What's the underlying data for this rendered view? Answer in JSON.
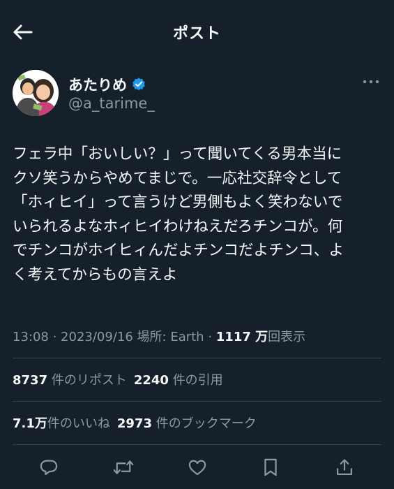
{
  "header": {
    "title": "ポスト",
    "back_icon": "arrow-left-icon"
  },
  "author": {
    "display_name": "あたりめ",
    "handle": "@a_tarime_",
    "verified": true,
    "verified_color": "#1d9bf0"
  },
  "tweet": {
    "lines": [
      "フェラ中「おいしい？」って聞いてくる男本当に",
      "クソ笑うからやめてまじで。一応社交辞令として",
      "「ホィヒイ」って言うけど男側もよく笑わないで",
      "いられるよなホィヒイわけねえだろチンコが。何",
      "でチンコがホイヒィんだよチンコだよチンコ、よ",
      "く考えてからもの言えよ"
    ],
    "time": "13:08",
    "date": "2023/09/16",
    "location": "場所: Earth",
    "views_number": "1117 万",
    "views_label": "回表示"
  },
  "stats": {
    "reposts": {
      "number": "8737",
      "label": "件のリポスト"
    },
    "quotes": {
      "number": "2240",
      "label": "件の引用"
    },
    "likes": {
      "number": "7.1万",
      "label": "件のいいね"
    },
    "bookmarks": {
      "number": "2973",
      "label": "件のブックマーク"
    }
  },
  "colors": {
    "background": "#15202b",
    "text": "#f7f9f9",
    "secondary": "#8b98a5",
    "divider": "#38444d"
  },
  "actions": [
    "reply-icon",
    "repost-icon",
    "like-icon",
    "bookmark-icon",
    "share-icon"
  ]
}
